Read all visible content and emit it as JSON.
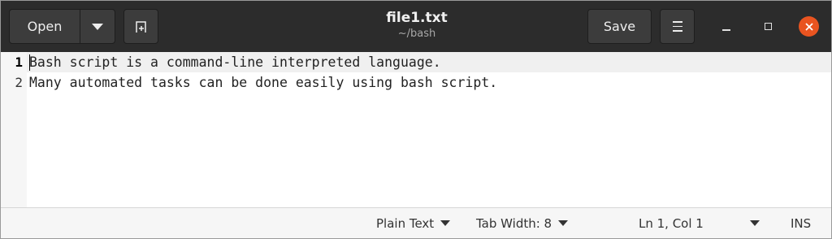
{
  "header": {
    "open_label": "Open",
    "title": "file1.txt",
    "subtitle": "~/bash",
    "save_label": "Save"
  },
  "editor": {
    "lines": [
      {
        "number": "1",
        "text": "Bash script is a command-line interpreted language."
      },
      {
        "number": "2",
        "text": "Many automated tasks can be done easily using bash script."
      }
    ]
  },
  "statusbar": {
    "language": "Plain Text",
    "tab_width": "Tab Width: 8",
    "cursor_position": "Ln 1, Col 1",
    "insert_mode": "INS"
  },
  "colors": {
    "headerbar": "#2c2c2c",
    "close_button": "#e95420"
  },
  "icons": [
    "chevron-down-icon",
    "new-tab-icon",
    "hamburger-menu-icon",
    "minimize-icon",
    "maximize-icon",
    "close-icon"
  ]
}
